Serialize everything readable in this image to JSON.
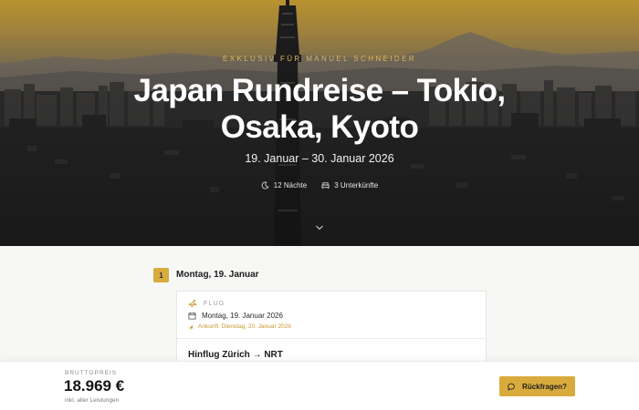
{
  "hero": {
    "eyebrow": "EXKLUSIV FÜR MANUEL SCHNEIDER",
    "title": "Japan Rundreise – Tokio, Osaka, Kyoto",
    "dates": "19. Januar – 30. Januar 2026",
    "nights": "12 Nächte",
    "accommodations": "3 Unterkünfte",
    "icons": [
      "moon-icon",
      "bed-icon",
      "chevron-down-icon"
    ]
  },
  "itinerary": {
    "day_number": "1",
    "day_title": "Montag, 19. Januar",
    "card": {
      "category": "FLUG",
      "date": "Montag, 19. Januar 2026",
      "arrival": "Ankunft: Dienstag, 20. Januar 2026",
      "route": "Hinflug Zürich → NRT",
      "icons": [
        "plane-icon",
        "calendar-icon",
        "arrival-plane-icon"
      ]
    }
  },
  "price_bar": {
    "label": "BRUTTOPREIS",
    "value": "18.969 €",
    "note": "inkl. aller Leistungen",
    "button_label": "Rückfragen?",
    "icons": [
      "chat-icon"
    ]
  },
  "colors": {
    "accent": "#d9ab3c",
    "accent_text": "#c79a2d",
    "hero_sky": "#b8922f",
    "hero_city": "#2e2d2d"
  }
}
